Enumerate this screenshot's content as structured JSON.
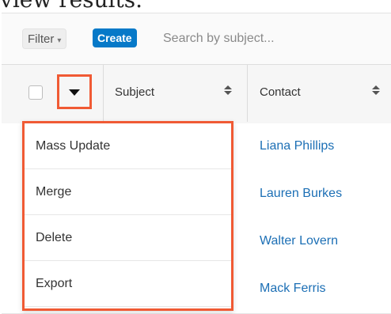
{
  "caption": "view results.",
  "toolbar": {
    "filter_label": "Filter",
    "filter_caret": "▾",
    "create_label": "Create",
    "search_placeholder": "Search by subject..."
  },
  "table": {
    "columns": [
      {
        "label": "Subject"
      },
      {
        "label": "Contact"
      }
    ],
    "rows": [
      {
        "contact": "Liana Phillips"
      },
      {
        "contact": "Lauren Burkes"
      },
      {
        "contact": "Walter Lovern"
      },
      {
        "contact": "Mack Ferris"
      }
    ]
  },
  "actions_menu": {
    "items": [
      {
        "label": "Mass Update"
      },
      {
        "label": "Merge"
      },
      {
        "label": "Delete"
      },
      {
        "label": "Export"
      }
    ]
  },
  "colors": {
    "accent": "#0679c8",
    "highlight": "#f05a34",
    "link": "#1c6fb5"
  }
}
